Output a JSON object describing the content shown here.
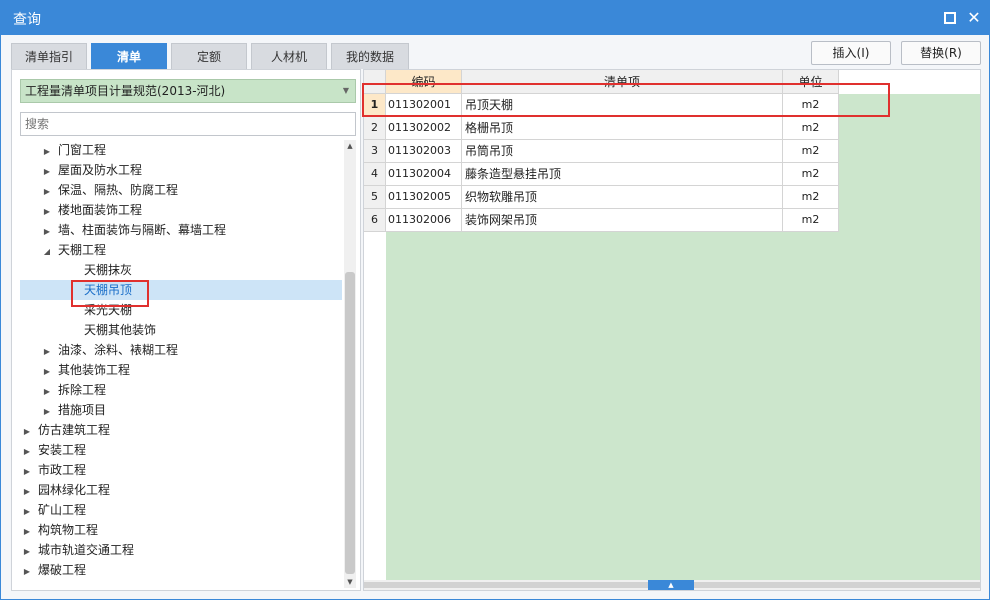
{
  "window": {
    "title": "查询"
  },
  "tabs": [
    {
      "label": "清单指引"
    },
    {
      "label": "清单",
      "active": true
    },
    {
      "label": "定额"
    },
    {
      "label": "人材机"
    },
    {
      "label": "我的数据"
    }
  ],
  "actions": {
    "insert_label": "插入(I)",
    "replace_label": "替换(R)"
  },
  "left": {
    "spec_select": "工程量清单项目计量规范(2013-河北)",
    "search_placeholder": "搜索",
    "tree": [
      {
        "label": "门窗工程",
        "state": "collapsed",
        "depth": 1
      },
      {
        "label": "屋面及防水工程",
        "state": "collapsed",
        "depth": 1
      },
      {
        "label": "保温、隔热、防腐工程",
        "state": "collapsed",
        "depth": 1
      },
      {
        "label": "楼地面装饰工程",
        "state": "collapsed",
        "depth": 1
      },
      {
        "label": "墙、柱面装饰与隔断、幕墙工程",
        "state": "collapsed",
        "depth": 1
      },
      {
        "label": "天棚工程",
        "state": "expanded",
        "depth": 1
      },
      {
        "label": "天棚抹灰",
        "state": "leaf",
        "depth": 2
      },
      {
        "label": "天棚吊顶",
        "state": "leaf",
        "depth": 2,
        "selected": true
      },
      {
        "label": "采光天棚",
        "state": "leaf",
        "depth": 2
      },
      {
        "label": "天棚其他装饰",
        "state": "leaf",
        "depth": 2
      },
      {
        "label": "油漆、涂料、裱糊工程",
        "state": "collapsed",
        "depth": 1
      },
      {
        "label": "其他装饰工程",
        "state": "collapsed",
        "depth": 1
      },
      {
        "label": "拆除工程",
        "state": "collapsed",
        "depth": 1
      },
      {
        "label": "措施项目",
        "state": "collapsed",
        "depth": 1
      },
      {
        "label": "仿古建筑工程",
        "state": "collapsed",
        "depth": 0
      },
      {
        "label": "安装工程",
        "state": "collapsed",
        "depth": 0
      },
      {
        "label": "市政工程",
        "state": "collapsed",
        "depth": 0
      },
      {
        "label": "园林绿化工程",
        "state": "collapsed",
        "depth": 0
      },
      {
        "label": "矿山工程",
        "state": "collapsed",
        "depth": 0
      },
      {
        "label": "构筑物工程",
        "state": "collapsed",
        "depth": 0
      },
      {
        "label": "城市轨道交通工程",
        "state": "collapsed",
        "depth": 0
      },
      {
        "label": "爆破工程",
        "state": "collapsed",
        "depth": 0
      }
    ]
  },
  "grid": {
    "columns": {
      "code": "编码",
      "name": "清单项",
      "unit": "单位"
    },
    "rows": [
      {
        "num": "1",
        "code": "011302001",
        "name": "吊顶天棚",
        "unit": "m2"
      },
      {
        "num": "2",
        "code": "011302002",
        "name": "格栅吊顶",
        "unit": "m2"
      },
      {
        "num": "3",
        "code": "011302003",
        "name": "吊筒吊顶",
        "unit": "m2"
      },
      {
        "num": "4",
        "code": "011302004",
        "name": "藤条造型悬挂吊顶",
        "unit": "m2"
      },
      {
        "num": "5",
        "code": "011302005",
        "name": "织物软雕吊顶",
        "unit": "m2"
      },
      {
        "num": "6",
        "code": "011302006",
        "name": "装饰网架吊顶",
        "unit": "m2"
      }
    ]
  },
  "colors": {
    "accent": "#3a88d8",
    "grid_background": "#cce6cc",
    "highlight": "#e0302e"
  }
}
